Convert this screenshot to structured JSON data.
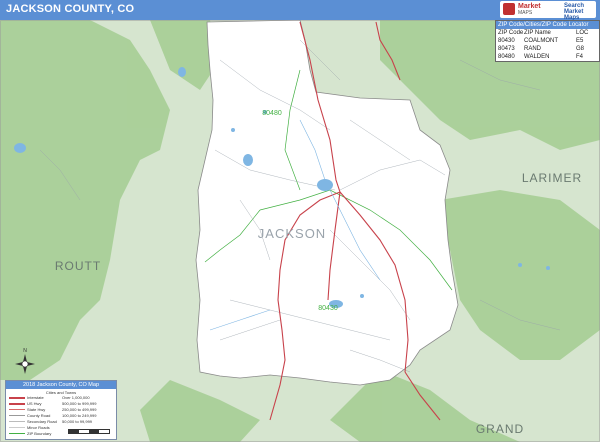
{
  "header": {
    "title": "JACKSON COUNTY, CO",
    "logo_text": "Market",
    "logo_sub": "MAPS",
    "logo_right": "Search Market Maps"
  },
  "map": {
    "county_label": "JACKSON",
    "neighbor_labels": [
      "LARIMER",
      "ROUTT",
      "GRAND"
    ],
    "zip_labels": [
      "80480",
      "80430"
    ],
    "colors": {
      "county_fill": "#ffffff",
      "outside_fill": "#d6e5cf",
      "forest_fill": "#a9cf98",
      "water": "#7fb6e3",
      "highway": "#c8424b",
      "zip_boundary": "#43b043",
      "county_border": "#8a8a8a",
      "header": "#5b8fd4"
    }
  },
  "zip_table": {
    "title": "ZIP Code/Cities/ZIP Code Locator",
    "headers": [
      "ZIP Code",
      "ZIP Name",
      "LOC"
    ],
    "rows": [
      [
        "80430",
        "COALMONT",
        "E5"
      ],
      [
        "80473",
        "RAND",
        "G8"
      ],
      [
        "80480",
        "WALDEN",
        "F4"
      ]
    ]
  },
  "legend": {
    "title": "2018 Jackson County, CO Map",
    "subtitle": "Cities and Towns",
    "left_items": [
      "Interstate",
      "US Hwy",
      "State Hwy",
      "County Road",
      "Secondary Road",
      "Minor Roads",
      "ZIP Boundary",
      "Cnty Boundary",
      "County Boundary"
    ],
    "right_items": [
      "Over 1,000,000",
      "500,000 to 999,999",
      "250,000 to 499,999",
      "100,000 to 249,999",
      "50,000 to 99,999",
      "25,000 to 49,999",
      "10,000 to 24,999",
      "Under 10,000"
    ]
  },
  "compass": {
    "label": "N"
  }
}
